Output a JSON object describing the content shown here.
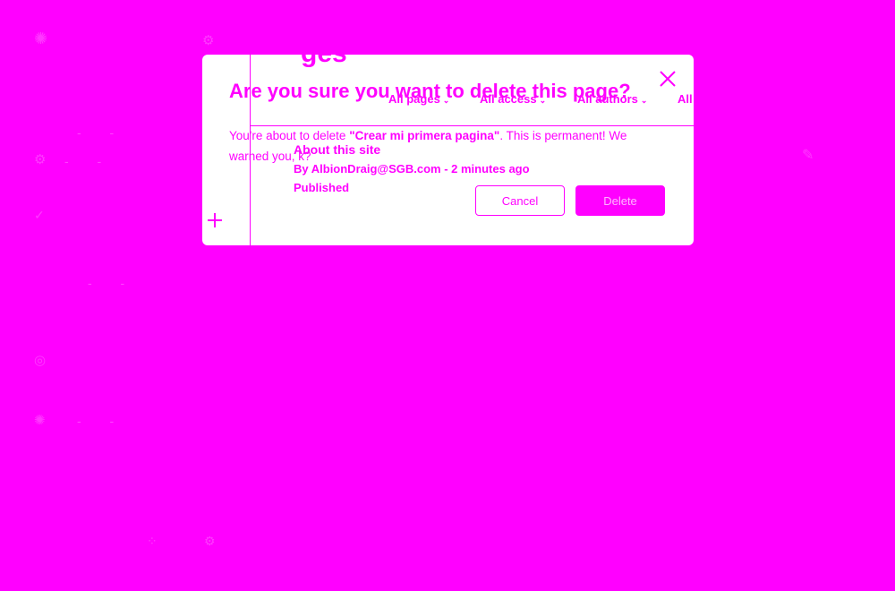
{
  "dialog": {
    "title": "Are you sure you want to delete this page?",
    "body_prefix": "You're about to delete ",
    "page_name": "\"Crear mi primera pagina\"",
    "body_suffix": ". This is permanent! We warned you, k?",
    "cancel_label": "Cancel",
    "delete_label": "Delete"
  },
  "background": {
    "title_peek": "ges",
    "filters": [
      {
        "label": "All pages"
      },
      {
        "label": "All access"
      },
      {
        "label": "All authors"
      },
      {
        "label": "All"
      }
    ],
    "card": {
      "title": "About this site",
      "meta": "By AlbionDraig@SGB.com - 2 minutes ago",
      "status": "Published"
    }
  },
  "colors": {
    "accent": "#ff00ff",
    "dialog_bg": "#ffffff"
  },
  "icons": [
    "close-icon",
    "plus-icon",
    "chevron-down-icon",
    "gear-icon",
    "pencil-icon"
  ]
}
